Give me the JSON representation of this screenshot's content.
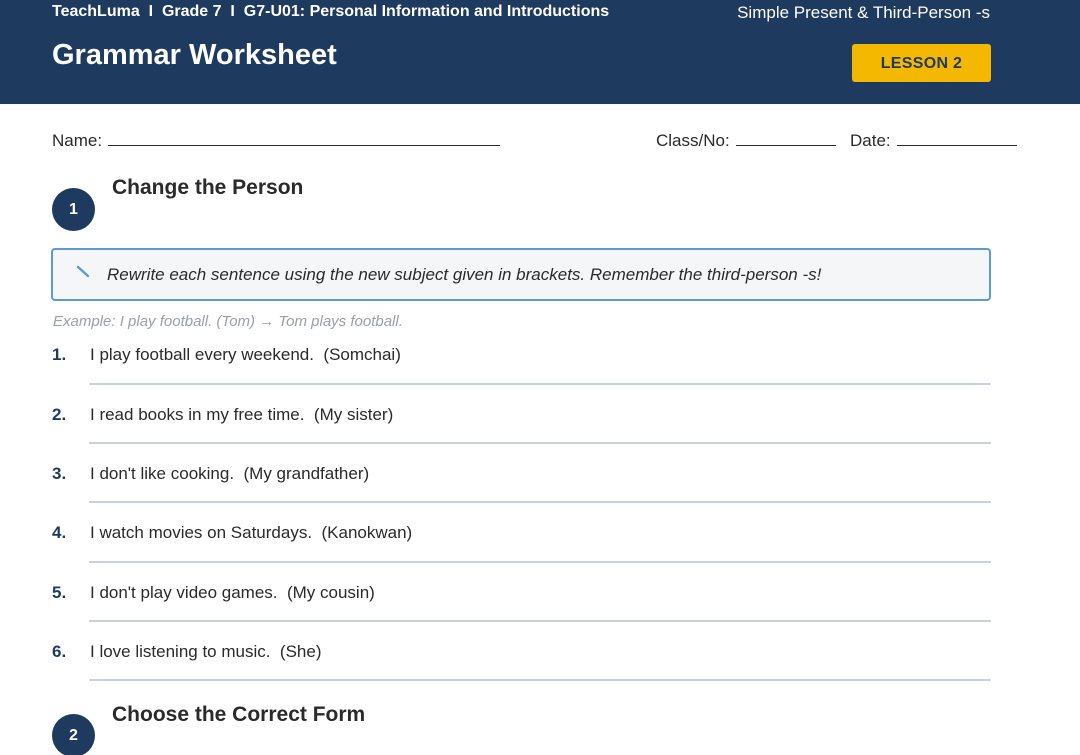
{
  "header": {
    "breadcrumb": "TeachLuma  I  Grade 7  I  G7-U01: Personal Information and Introductions",
    "topic": "Simple Present & Third-Person -s",
    "title": "Grammar Worksheet",
    "lesson_badge": "LESSON 2",
    "colors": {
      "header_bg": "#1f3a5f",
      "badge_bg": "#f5b800"
    }
  },
  "fields": {
    "name_label": "Name:",
    "class_label": "Class/No:",
    "date_label": "Date:"
  },
  "sections": [
    {
      "number": "1",
      "title": "Change the Person",
      "instructions": "Rewrite each sentence using the new subject given in brackets. Remember the third-person -s!",
      "instructions_icon": "pencil-icon",
      "example": "Example: I play football. (Tom) → Tom plays football.",
      "questions": [
        {
          "number": "1.",
          "text": "I play football every weekend.  (Somchai)"
        },
        {
          "number": "2.",
          "text": "I read books in my free time.  (My sister)"
        },
        {
          "number": "3.",
          "text": "I don't like cooking.  (My grandfather)"
        },
        {
          "number": "4.",
          "text": "I watch movies on Saturdays.  (Kanokwan)"
        },
        {
          "number": "5.",
          "text": "I don't play video games.  (My cousin)"
        },
        {
          "number": "6.",
          "text": "I love listening to music.  (She)"
        }
      ]
    },
    {
      "number": "2",
      "title": "Choose the Correct Form"
    }
  ]
}
